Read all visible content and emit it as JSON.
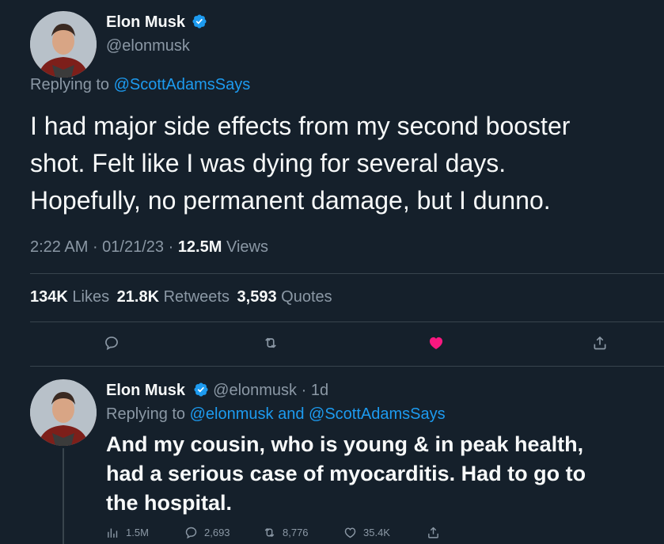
{
  "main_tweet": {
    "author_name": "Elon Musk",
    "handle": "@elonmusk",
    "replying_prefix": "Replying to",
    "replying_to": "@ScottAdamsSays",
    "text_line1": "I had major side effects from my second booster",
    "text_line2": "shot. Felt like I was dying for several days.",
    "text_line3": "Hopefully, no permanent damage, but I dunno.",
    "time": "2:22 AM",
    "date": "01/21/23",
    "views_count": "12.5M",
    "views_label": "Views",
    "likes_count": "134K",
    "likes_label": "Likes",
    "retweets_count": "21.8K",
    "retweets_label": "Retweets",
    "quotes_count": "3,593",
    "quotes_label": "Quotes",
    "liked": true
  },
  "reply_tweet": {
    "author_name": "Elon Musk",
    "handle": "@elonmusk",
    "age": "1d",
    "replying_prefix": "Replying to",
    "replying_to_1": "@elonmusk",
    "and_word": "and",
    "replying_to_2": "@ScottAdamsSays",
    "text_line1": "And my cousin, who is young & in peak health,",
    "text_line2": "had a serious case of myocarditis. Had to go to",
    "text_line3": "the hospital.",
    "views": "1.5M",
    "replies": "2,693",
    "retweets": "8,776",
    "likes": "35.4K"
  },
  "colors": {
    "background": "#15202b",
    "text": "#f7f9f9",
    "muted": "#8b98a5",
    "accent": "#1d9bf0",
    "like": "#f91880"
  },
  "icons": {
    "reply": "reply-icon",
    "retweet": "retweet-icon",
    "like": "heart-icon",
    "share": "share-icon",
    "views": "views-icon",
    "verified": "verified-badge-icon"
  }
}
